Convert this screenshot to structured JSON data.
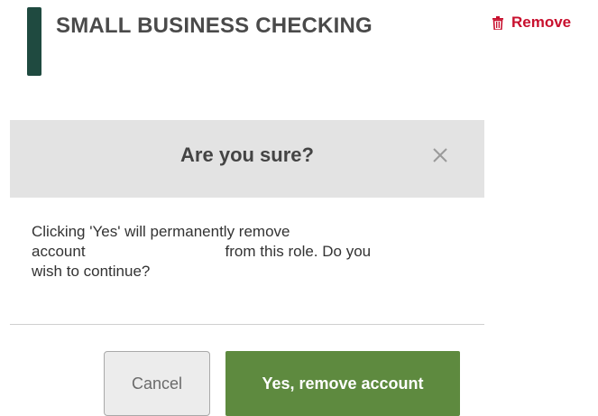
{
  "account": {
    "title": "SMALL BUSINESS CHECKING",
    "remove_label": "Remove",
    "remove_icon": "trash-icon"
  },
  "modal": {
    "title": "Are you sure?",
    "close_icon": "close-icon",
    "message_line1": "Clicking 'Yes' will permanently remove",
    "message_line2_start": "account",
    "message_line2_end": "from this role. Do you",
    "message_line3": "wish to continue?",
    "cancel_label": "Cancel",
    "confirm_label": "Yes, remove account"
  },
  "colors": {
    "accent_bar": "#1f4a40",
    "remove_red": "#c8102e",
    "confirm_green": "#5e8a3f",
    "header_gray": "#e3e3e3"
  }
}
